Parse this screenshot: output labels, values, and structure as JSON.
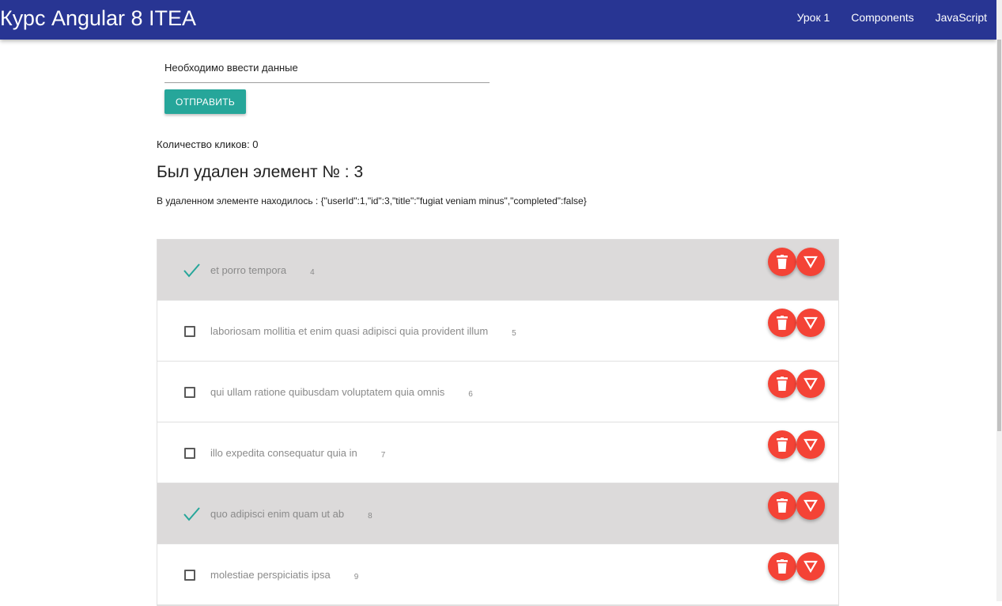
{
  "app": {
    "title": "Курс Angular 8 ITEA"
  },
  "nav": {
    "items": [
      "Урок 1",
      "Components",
      "JavaScript"
    ]
  },
  "form": {
    "input_value": "",
    "input_placeholder": "Необходимо ввести данные",
    "submit_label": "ОТПРАВИТЬ"
  },
  "clicks": {
    "text": "Количество кликов: 0"
  },
  "deleted": {
    "title": "Был удален элемент № : 3",
    "info": "В удаленном элементе находилось : {\"userId\":1,\"id\":3,\"title\":\"fugiat veniam minus\",\"completed\":false}"
  },
  "todos": [
    {
      "title": "et porro tempora",
      "id": "4",
      "completed": true
    },
    {
      "title": "laboriosam mollitia et enim quasi adipisci quia provident illum",
      "id": "5",
      "completed": false
    },
    {
      "title": "qui ullam ratione quibusdam voluptatem quia omnis",
      "id": "6",
      "completed": false
    },
    {
      "title": "illo expedita consequatur quia in",
      "id": "7",
      "completed": false
    },
    {
      "title": "quo adipisci enim quam ut ab",
      "id": "8",
      "completed": true
    },
    {
      "title": "molestiae perspiciatis ipsa",
      "id": "9",
      "completed": false
    }
  ],
  "colors": {
    "navbar": "#283593",
    "submit_button": "#26a69a",
    "action_button": "#f44336",
    "completed_row": "#dcdada",
    "check_mark": "#26a69a"
  },
  "icons": {
    "delete": "trash-icon",
    "toggle": "triangle-down-icon",
    "checked": "check-icon",
    "unchecked": "checkbox-icon"
  }
}
